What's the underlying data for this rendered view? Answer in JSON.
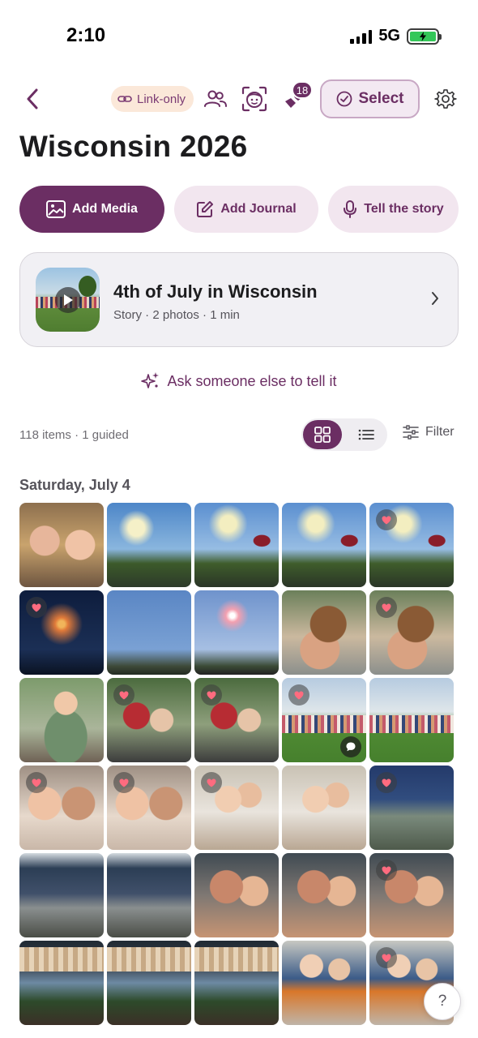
{
  "status": {
    "time": "2:10",
    "network": "5G"
  },
  "nav": {
    "link_only_label": "Link-only",
    "notification_count": "18",
    "select_label": "Select"
  },
  "album": {
    "title": "Wisconsin 2026"
  },
  "actions": {
    "add_media": "Add Media",
    "add_journal": "Add Journal",
    "tell_story": "Tell the story"
  },
  "story": {
    "title": "4th of July in Wisconsin",
    "meta": "Story · 2 photos · 1 min"
  },
  "ask_label": "Ask someone else to tell it",
  "toolbar": {
    "count": "118 items · 1 guided",
    "filter_label": "Filter",
    "view_mode": "grid"
  },
  "section": {
    "date": "Saturday, July 4"
  },
  "colors": {
    "accent": "#6b2e63",
    "accent_soft": "#f2e6ef",
    "link_only_bg": "#fbe8d9"
  },
  "help_label": "?",
  "photos": [
    {
      "kind": "selfie",
      "heart": false,
      "comment": false
    },
    {
      "kind": "fireworks-day",
      "heart": false,
      "comment": false
    },
    {
      "kind": "fireworks-umbrella",
      "heart": false,
      "comment": false
    },
    {
      "kind": "fireworks-umbrella",
      "heart": false,
      "comment": false
    },
    {
      "kind": "fireworks-umbrella",
      "heart": true,
      "comment": false
    },
    {
      "kind": "fireworks-night",
      "heart": true,
      "comment": false
    },
    {
      "kind": "sky",
      "heart": false,
      "comment": false
    },
    {
      "kind": "sky-fw",
      "heart": false,
      "comment": false
    },
    {
      "kind": "dog",
      "heart": false,
      "comment": false
    },
    {
      "kind": "dog",
      "heart": true,
      "comment": false
    },
    {
      "kind": "boy",
      "heart": false,
      "comment": false
    },
    {
      "kind": "family",
      "heart": true,
      "comment": false
    },
    {
      "kind": "family",
      "heart": true,
      "comment": false
    },
    {
      "kind": "crowd",
      "heart": true,
      "comment": true
    },
    {
      "kind": "crowd",
      "heart": false,
      "comment": false
    },
    {
      "kind": "couple",
      "heart": true,
      "comment": false
    },
    {
      "kind": "couple",
      "heart": true,
      "comment": false
    },
    {
      "kind": "kid-mom",
      "heart": true,
      "comment": false
    },
    {
      "kind": "kid-mom",
      "heart": false,
      "comment": false
    },
    {
      "kind": "shade",
      "heart": true,
      "comment": false
    },
    {
      "kind": "patio",
      "heart": false,
      "comment": false
    },
    {
      "kind": "patio",
      "heart": false,
      "comment": false
    },
    {
      "kind": "kiss",
      "heart": false,
      "comment": false
    },
    {
      "kind": "kiss",
      "heart": false,
      "comment": false
    },
    {
      "kind": "kiss",
      "heart": true,
      "comment": false
    },
    {
      "kind": "awning",
      "heart": false,
      "comment": false
    },
    {
      "kind": "awning",
      "heart": false,
      "comment": false
    },
    {
      "kind": "awning",
      "heart": false,
      "comment": false
    },
    {
      "kind": "kids-boat",
      "heart": false,
      "comment": false
    },
    {
      "kind": "kids-boat",
      "heart": true,
      "comment": false
    }
  ]
}
